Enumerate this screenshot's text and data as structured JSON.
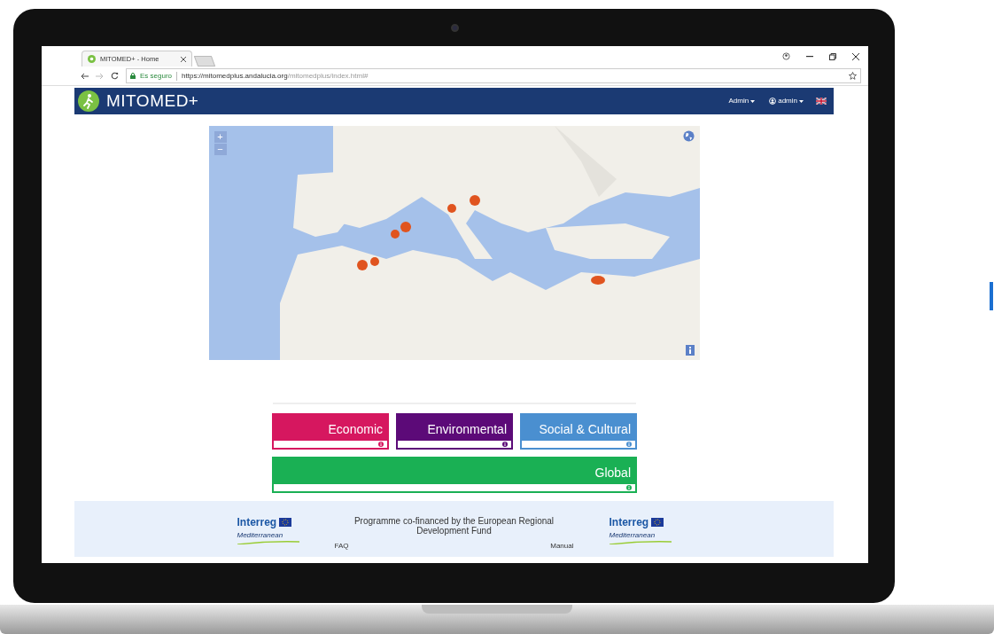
{
  "browser": {
    "tab_title": "MITOMED+ - Home",
    "secure_label": "Es seguro",
    "url_host": "https://mitomedplus.andalucia.org",
    "url_path": "/mitomedplus/index.html#"
  },
  "navbar": {
    "brand": "MITOMED+",
    "menus": [
      {
        "label": "Admin",
        "kind": "dropdown"
      },
      {
        "label": "admin",
        "kind": "user"
      }
    ]
  },
  "map": {
    "zoom_in": "+",
    "zoom_out": "−"
  },
  "indicators": [
    {
      "label": "Economic",
      "color": "#d6175f"
    },
    {
      "label": "Environmental",
      "color": "#5c0a78"
    },
    {
      "label": "Social & Cultural",
      "color": "#4a8fd0"
    },
    {
      "label": "Global",
      "color": "#1ab054"
    }
  ],
  "footer": {
    "logos": [
      {
        "line1": "Interreg",
        "line2": "Mediterranean"
      },
      {
        "line1": "Interreg",
        "line2": "Mediterranean"
      }
    ],
    "funding_text": "Programme co-financed by the European Regional Development Fund",
    "links": [
      "FAQ",
      "Manual"
    ]
  }
}
